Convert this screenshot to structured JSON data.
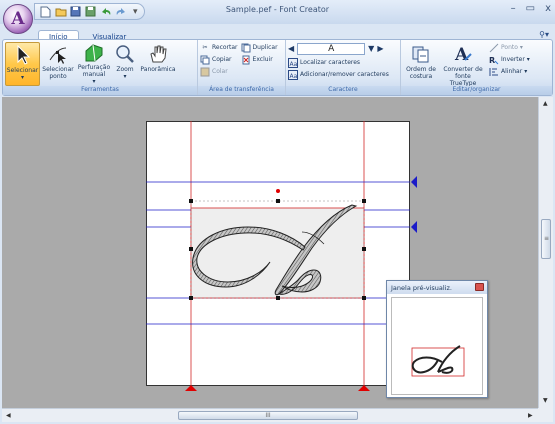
{
  "window": {
    "title": "Sample.pef - Font Creator",
    "orb_letter": "A",
    "controls": [
      "–",
      "▭",
      "x"
    ]
  },
  "tabs": [
    {
      "label": "Início",
      "active": true
    },
    {
      "label": "Visualizar",
      "active": false
    }
  ],
  "groups": {
    "tools": {
      "label": "Ferramentas",
      "buttons": [
        {
          "label": "Selecionar",
          "sub": "▾",
          "icon": "arrow-cursor-icon"
        },
        {
          "label": "Selecionar ponto",
          "sub": "",
          "icon": "point-cursor-icon"
        },
        {
          "label": "Perfuração manual",
          "sub": "▾",
          "icon": "manual-punch-icon"
        },
        {
          "label": "Zoom",
          "sub": "▾",
          "icon": "magnifier-icon"
        },
        {
          "label": "Panorâmica",
          "sub": "",
          "icon": "hand-icon"
        }
      ]
    },
    "clipboard": {
      "label": "Área de transferência",
      "col1": [
        {
          "label": "Recortar",
          "enabled": true
        },
        {
          "label": "Copiar",
          "enabled": true
        },
        {
          "label": "Colar",
          "enabled": false
        }
      ],
      "col2": [
        {
          "label": "Duplicar",
          "enabled": true
        },
        {
          "label": "Excluir",
          "enabled": true
        }
      ]
    },
    "character": {
      "label": "Caractere",
      "current": "A",
      "find": "Localizar caracteres",
      "addremove": "Adicionar/remover caracteres"
    },
    "edit": {
      "label": "Editar/organizar",
      "order_label": "Ordem de costura",
      "convert_label": "Converter de fonte TrueType",
      "point": "Ponto",
      "invert": "Inverter",
      "align": "Alinhar"
    }
  },
  "preview": {
    "title": "Janela pré-visualiz."
  },
  "scroll": {
    "hthumb_grip": "III",
    "vthumb_grip": "≡"
  },
  "colors": {
    "guide_blue": "#1c1cc8",
    "guide_red": "#d22828",
    "marker_red": "#e00000",
    "workspace": "#aaaaaa"
  }
}
